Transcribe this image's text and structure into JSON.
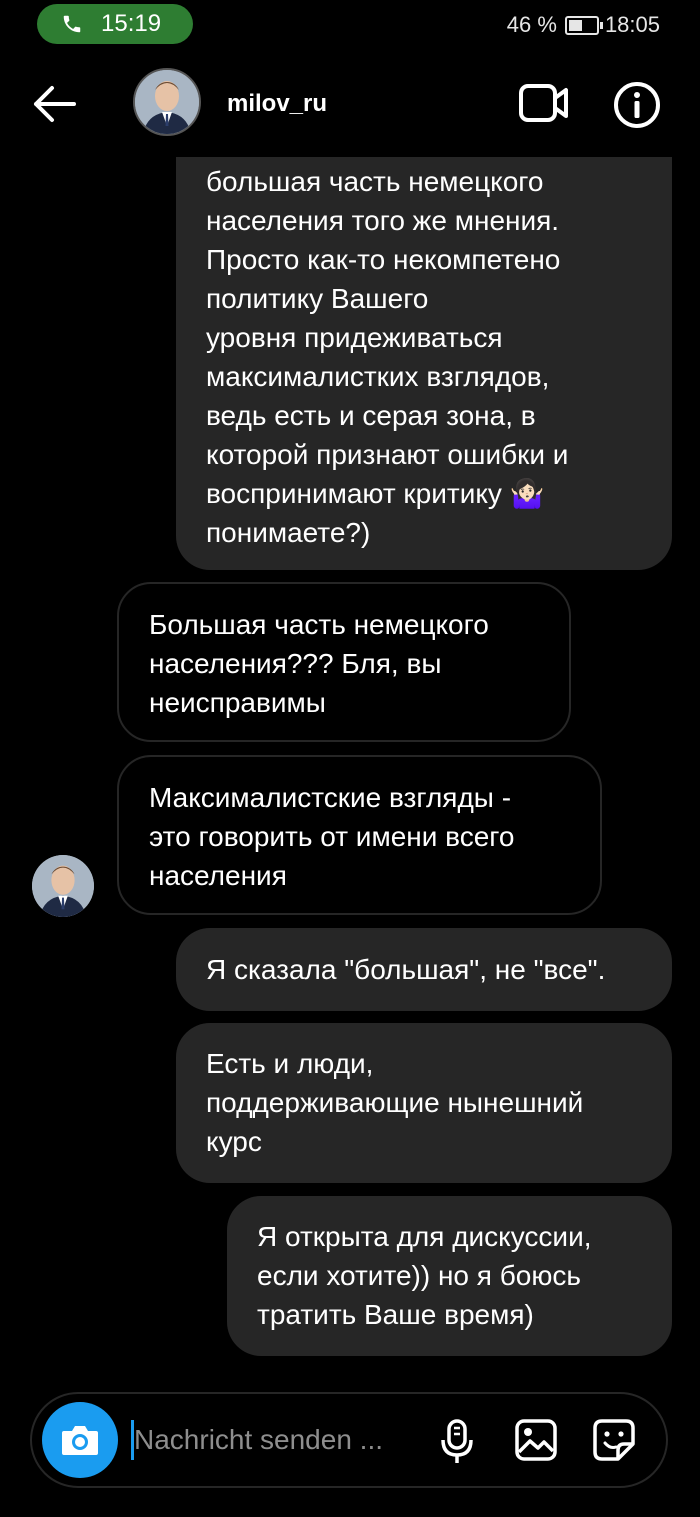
{
  "status_bar": {
    "call_time": "15:19",
    "battery": "46 %",
    "clock": "18:05"
  },
  "header": {
    "username": "milov_ru"
  },
  "messages": [
    {
      "from": "me",
      "lines": [
        "большая часть немецкого",
        "населения того же мнения.",
        "Просто как-то некомпетено",
        "политику Вашего",
        "уровня придеживаться",
        "максималистких взглядов,",
        "ведь есть и серая зона, в",
        "которой признают ошибки и",
        "воспринимают критику 🤷🏻‍♀️",
        "понимаете?)"
      ]
    },
    {
      "from": "them",
      "lines": [
        "Большая часть немецкого",
        "населения??? Бля, вы",
        "неисправимы"
      ]
    },
    {
      "from": "them",
      "lines": [
        "Максималистские взгляды -",
        "это говорить от имени всего",
        "населения"
      ]
    },
    {
      "from": "me",
      "lines": [
        "Я сказала \"большая\", не \"все\"."
      ]
    },
    {
      "from": "me",
      "lines": [
        "Есть и люди,",
        "поддерживающие нынешний",
        "курс"
      ]
    },
    {
      "from": "me",
      "lines": [
        "Я открыта для дискуссии,",
        "если хотите)) но я боюсь",
        "тратить Ваше время)"
      ]
    }
  ],
  "composer": {
    "placeholder": "Nachricht senden ..."
  }
}
